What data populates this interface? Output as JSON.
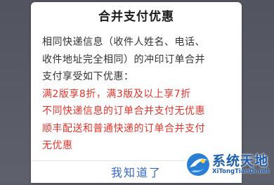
{
  "dialog": {
    "title": "合并支付优惠",
    "body_lines": [
      {
        "text": "相同快递信息（收件人姓名、电话、",
        "color": "#333333"
      },
      {
        "text": "收件地址完全相同）的冲印订单合并",
        "color": "#333333"
      },
      {
        "text": "支付享受如下优惠：",
        "color": "#333333"
      },
      {
        "text": "满2版享8折，满3版及以上享7折",
        "color": "#e0342b"
      },
      {
        "text": "不同快递信息的订单合并支付无优惠",
        "color": "#e0342b"
      },
      {
        "text": "顺丰配送和普通快递的订单合并支付",
        "color": "#e0342b"
      },
      {
        "text": "无优惠",
        "color": "#e0342b"
      }
    ],
    "confirm_label": "我知道了"
  },
  "watermark": {
    "name": "系统天地",
    "url": "XiTongTianDi.net"
  },
  "colors": {
    "accent": "#3566c8",
    "highlight": "#e0342b",
    "backdrop": "#5b5d68"
  }
}
